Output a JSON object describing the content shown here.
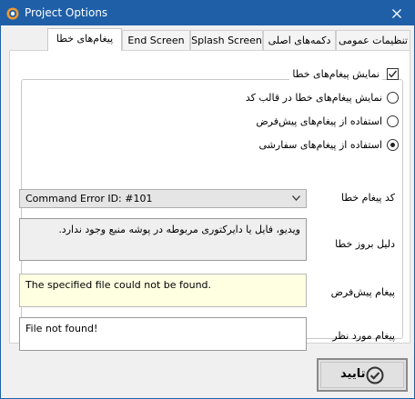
{
  "window": {
    "title": "Project Options",
    "close_label": "✕"
  },
  "tabs": [
    {
      "label": "تنظیمات عمومی"
    },
    {
      "label": "دکمه‌های اصلی"
    },
    {
      "label": "Splash Screen"
    },
    {
      "label": "End Screen"
    },
    {
      "label": "پیغام‌های خطا",
      "active": true
    }
  ],
  "error_messages": {
    "show_errors": {
      "label": "نمایش پیغام‌های خطا",
      "checked": true
    },
    "options": [
      {
        "label": "نمایش پیغام‌های خطا در قالب کد",
        "checked": false
      },
      {
        "label": "استفاده از پیغام‌های پیش‌فرض",
        "checked": false
      },
      {
        "label": "استفاده از پیغام‌های سفارشی",
        "checked": true
      }
    ],
    "error_code": {
      "label": "کد پیغام خطا",
      "value": "Command Error ID: #101"
    },
    "cause": {
      "label": "دلیل بروز خطا",
      "value": "ویدیو، فایل یا دایرکتوری مربوطه در پوشه منبع وجود ندارد."
    },
    "default_message": {
      "label": "پیغام پیش‌فرض",
      "value": "The specified file could not be found."
    },
    "custom_message": {
      "label": "پیغام مورد نظر",
      "value": "File not found!"
    }
  },
  "footer": {
    "ok_label": "تایید"
  },
  "colors": {
    "titlebar": "#1f5fa8",
    "window_bg": "#f0f0f0",
    "default_message_bg": "#ffffe1"
  }
}
